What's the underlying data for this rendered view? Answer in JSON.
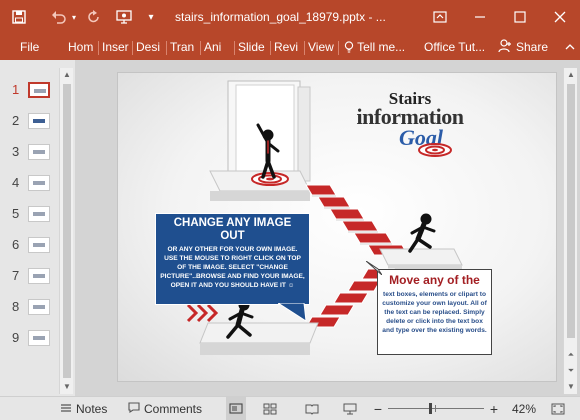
{
  "titlebar": {
    "save_icon": "save-icon",
    "undo_icon": "undo-icon",
    "redo_icon": "redo-icon",
    "present_icon": "present-from-start-icon",
    "customize_icon": "customize-qat-icon",
    "title": "stairs_information_goal_18979.pptx - ...",
    "ribbon_display_icon": "ribbon-display-options-icon",
    "minimize_icon": "minimize-icon",
    "restore_icon": "restore-icon",
    "close_icon": "close-icon",
    "bg_color": "#b7472a"
  },
  "ribbon": {
    "tabs": [
      "File",
      "Hom",
      "Inser",
      "Desi",
      "Tran",
      "Ani",
      "Slide",
      "Revi",
      "View"
    ],
    "tell_me": "Tell me...",
    "office_tut": "Office Tut...",
    "share": "Share",
    "collapse_icon": "chevron-up-icon"
  },
  "thumbnails": {
    "active": 1,
    "items": [
      {
        "num": "1"
      },
      {
        "num": "2"
      },
      {
        "num": "3"
      },
      {
        "num": "4"
      },
      {
        "num": "5"
      },
      {
        "num": "6"
      },
      {
        "num": "7"
      },
      {
        "num": "8"
      },
      {
        "num": "9"
      }
    ]
  },
  "slide": {
    "logo": {
      "line1": "Stairs",
      "line2": "information",
      "line3": "Goal"
    },
    "bluebox": {
      "heading": "CHANGE ANY IMAGE OUT",
      "body": "OR ANY OTHER FOR YOUR OWN IMAGE. USE THE MOUSE TO RIGHT CLICK ON TOP OF THE IMAGE. SELECT \"CHANGE PICTURE\"..BROWSE AND FIND YOUR IMAGE, OPEN IT AND YOU SHOULD HAVE IT ☺"
    },
    "whitebox": {
      "heading": "Move any of the",
      "body": "text boxes, elements or clipart to customize your own layout. All of the text can be replaced. Simply delete or click into the text box and type over the existing words."
    },
    "accent_red": "#c62828",
    "accent_blue": "#1f4f8f"
  },
  "statusbar": {
    "notes": "Notes",
    "comments": "Comments",
    "zoom": "42%",
    "notes_icon": "notes-icon",
    "comments_icon": "comments-icon",
    "normal_view_icon": "normal-view-icon",
    "slide_sorter_icon": "slide-sorter-icon",
    "reading_view_icon": "reading-view-icon",
    "slideshow_icon": "slideshow-icon",
    "fit_icon": "fit-to-window-icon"
  }
}
